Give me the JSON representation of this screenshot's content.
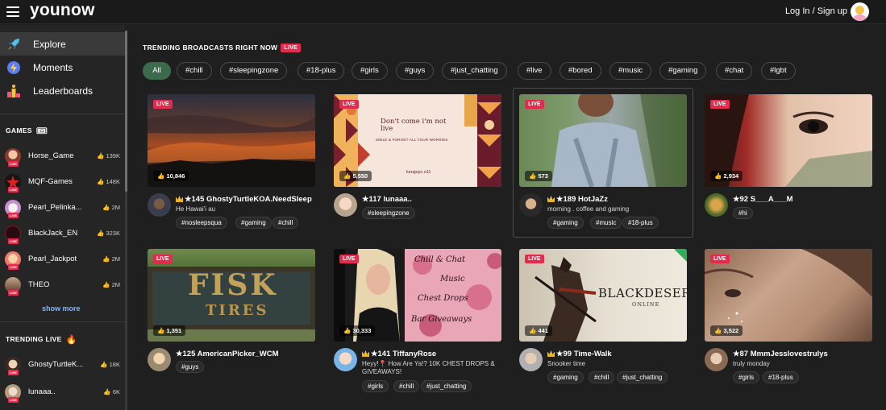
{
  "header": {
    "logo": "younow",
    "login_label": "Log In / Sign up"
  },
  "sidebar": {
    "nav": [
      {
        "label": "Explore"
      },
      {
        "label": "Moments"
      },
      {
        "label": "Leaderboards"
      }
    ],
    "games_title": "GAMES",
    "games": [
      {
        "name": "Horse_Game",
        "count": "139K"
      },
      {
        "name": "MQF-Games",
        "count": "148K"
      },
      {
        "name": "Pearl_Pelinka...",
        "count": "2M"
      },
      {
        "name": "BlackJack_EN",
        "count": "323K"
      },
      {
        "name": "Pearl_Jackpot",
        "count": "2M"
      },
      {
        "name": "THEO",
        "count": "2M"
      }
    ],
    "show_more": "show more",
    "trending_title": "TRENDING LIVE",
    "trending": [
      {
        "name": "GhostyTurtleK...",
        "count": "18K"
      },
      {
        "name": "lunaaa..",
        "count": "6K"
      }
    ],
    "live_label": "LIVE"
  },
  "main": {
    "title": "TRENDING BROADCASTS RIGHT NOW",
    "live_label": "LIVE",
    "chips": [
      "All",
      "#chill",
      "#sleepingzone",
      "#18-plus",
      "#girls",
      "#guys",
      "#just_chatting",
      "#live",
      "#bored",
      "#music",
      "#gaming",
      "#chat",
      "#lgbt"
    ],
    "cards": [
      {
        "viewers": "10,846",
        "name": "★145 GhostyTurtleKOA.NeedSleep",
        "desc": "He Hawai'i au",
        "tags": [
          "#nosleepsqua",
          "#gaming",
          "#chill"
        ]
      },
      {
        "viewers": "5,550",
        "name": "★117 lunaaa..",
        "desc": "",
        "tags": [
          "#sleepingzone"
        ],
        "thumb_text": {
          "line1": "Don't come i'm not live",
          "line2": "SMILE & FORGET ALL YOUR WORRIES",
          "handle": "lunajoyc.o11"
        }
      },
      {
        "viewers": "573",
        "name": "★189 HotJaZz",
        "desc": "morning . coffee and gaming",
        "tags": [
          "#gaming",
          "#music",
          "#18-plus"
        ]
      },
      {
        "viewers": "2,934",
        "name": "★92 S___A___M",
        "desc": "",
        "tags": [
          "#hi"
        ]
      },
      {
        "viewers": "1,351",
        "name": "★125 AmericanPicker_WCM",
        "desc": "",
        "tags": [
          "#guys"
        ],
        "thumb_text": {
          "line1": "FISK",
          "line2": "TIRES"
        }
      },
      {
        "viewers": "30,333",
        "name": "★141 TiffanyRose",
        "desc": "Heyy!📍 How Are Ya!? 10K CHEST DROPS & GIVEAWAYS!",
        "tags": [
          "#girls",
          "#chill",
          "#just_chatting"
        ],
        "thumb_text": {
          "line1": "Chill & Chat",
          "line2": "Music",
          "line3": "Chest Drops",
          "line4": "Bar Giveaways"
        }
      },
      {
        "viewers": "441",
        "name": "★99 Time-Walk",
        "desc": "Snooker time",
        "tags": [
          "#gaming",
          "#chill",
          "#just_chatting"
        ],
        "thumb_text": {
          "line1": "BLACKDESERT",
          "line2": "ONLINE"
        }
      },
      {
        "viewers": "3,522",
        "name": "★87 MmmJesslovestrulys",
        "desc": "truly monday",
        "tags": [
          "#girls",
          "#18-plus"
        ]
      }
    ]
  }
}
